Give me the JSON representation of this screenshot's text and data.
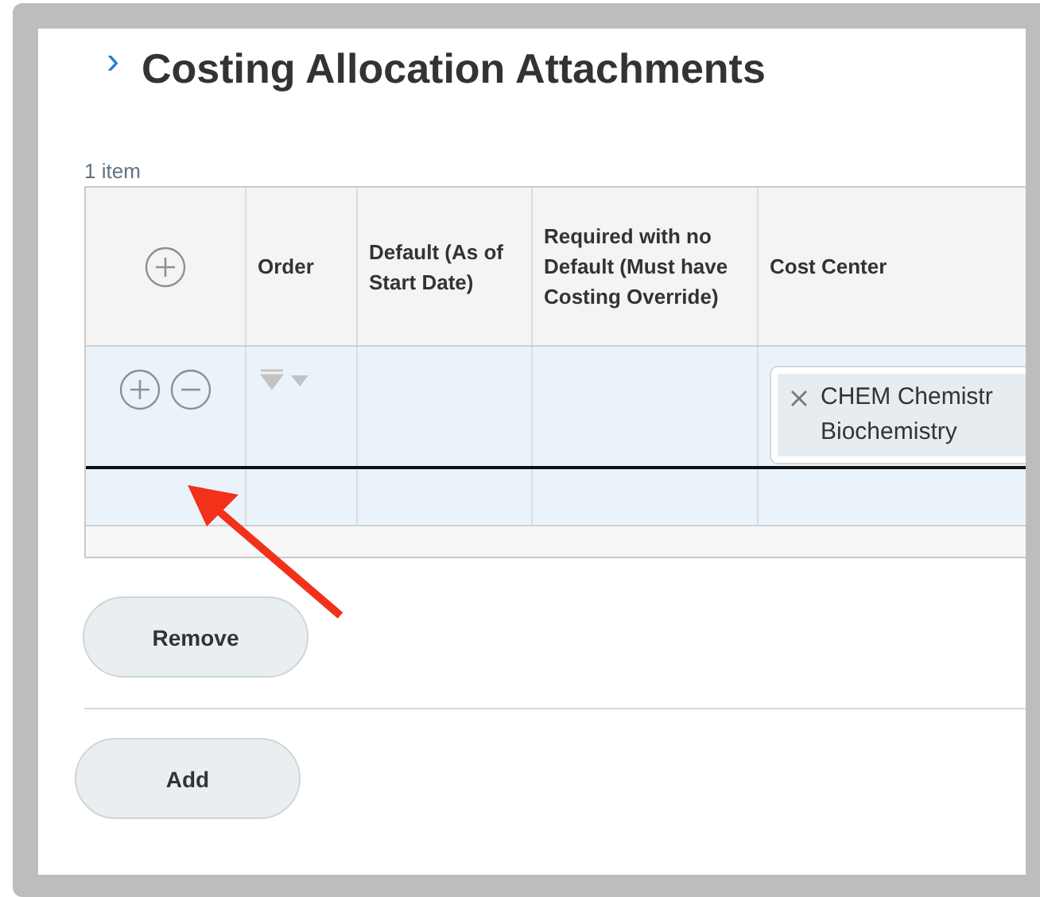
{
  "section": {
    "chevron": "›",
    "title": "Costing Allocation Attachments",
    "item_count": "1 item"
  },
  "table": {
    "columns": [
      "Order",
      "Default (As of Start Date)",
      "Required with no Default (Must have Costing Override)",
      "Cost Center"
    ],
    "rows": [
      {
        "cost_center": "CHEM Chemistr\nBiochemistry"
      }
    ]
  },
  "buttons": [
    {
      "label": "Remove"
    },
    {
      "label": "Add"
    }
  ]
}
